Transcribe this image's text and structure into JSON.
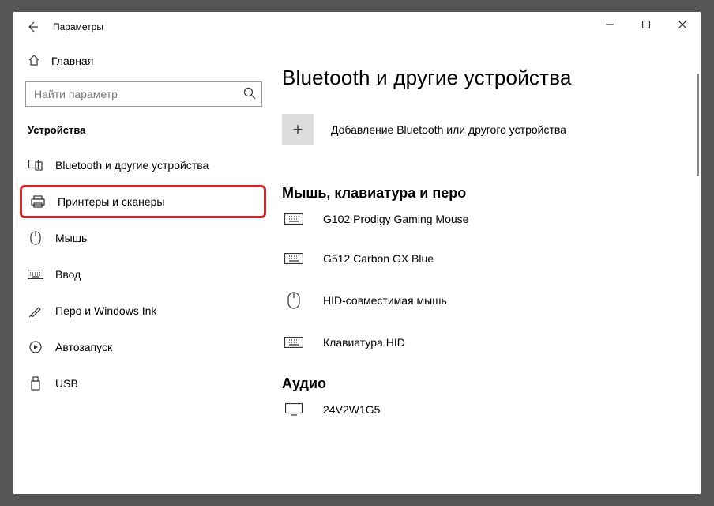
{
  "titlebar": {
    "title": "Параметры"
  },
  "sidebar": {
    "home": "Главная",
    "search_placeholder": "Найти параметр",
    "section": "Устройства",
    "items": [
      {
        "label": "Bluetooth и другие устройства"
      },
      {
        "label": "Принтеры и сканеры"
      },
      {
        "label": "Мышь"
      },
      {
        "label": "Ввод"
      },
      {
        "label": "Перо и Windows Ink"
      },
      {
        "label": "Автозапуск"
      },
      {
        "label": "USB"
      }
    ]
  },
  "main": {
    "heading": "Bluetooth и другие устройства",
    "add_device": "Добавление Bluetooth или другого устройства",
    "section1": "Мышь, клавиатура и перо",
    "devices": [
      {
        "label": "G102 Prodigy Gaming Mouse"
      },
      {
        "label": "G512 Carbon GX Blue"
      },
      {
        "label": "HID-совместимая мышь"
      },
      {
        "label": "Клавиатура HID"
      }
    ],
    "section2": "Аудио",
    "audio": [
      {
        "label": "24V2W1G5"
      }
    ]
  }
}
